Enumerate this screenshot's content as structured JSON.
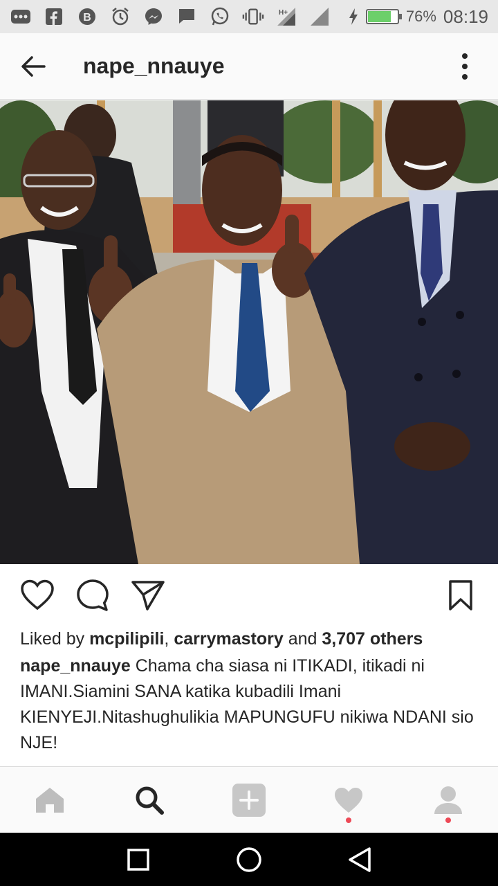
{
  "status_bar": {
    "icons": [
      "more-icon",
      "flipboard-icon",
      "b-icon",
      "alarm-icon",
      "messenger-icon",
      "message-icon",
      "whatsapp-icon",
      "vibrate-icon",
      "signal-h-icon",
      "signal-icon"
    ],
    "battery_percent": "76%",
    "battery_level": 0.76,
    "time": "08:19"
  },
  "header": {
    "title": "nape_nnauye"
  },
  "post": {
    "likes_prefix": "Liked by ",
    "liker1": "mcpilipili",
    "sep": ", ",
    "liker2": "carrymastory",
    "and": " and ",
    "others_count": "3,707 others",
    "caption_user": "nape_nnauye",
    "caption_text": " Chama cha siasa ni ITIKADI, itikadi ni IMANI.Siamini SANA katika kubadili Imani KIENYEJI.Nitashughulikia MAPUNGUFU nikiwa NDANI sio NJE!"
  },
  "colors": {
    "notification_dot": "#ed4956",
    "battery_fill": "#6ccf6a"
  }
}
